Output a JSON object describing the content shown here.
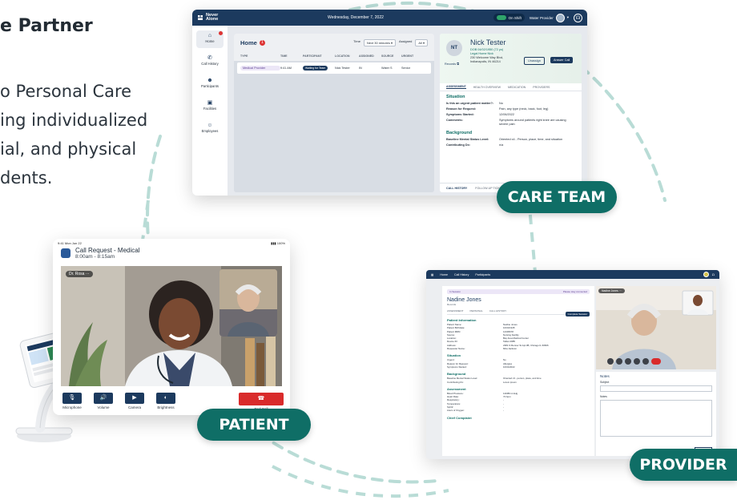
{
  "marketing": {
    "headline": "e Partner",
    "lead_lines": [
      "o Personal Care",
      "ing individualized",
      "ial, and physical",
      "dents."
    ]
  },
  "badges": {
    "care_team": "CARE TEAM",
    "patient": "PATIENT",
    "provider": "PROVIDER"
  },
  "colors": {
    "brand_navy": "#1c3a5e",
    "brand_teal": "#0f6e66",
    "end_call_red": "#d92b2b"
  },
  "care_team": {
    "logo_line1": "Never",
    "logo_line2": "Alone",
    "date": "Wednesday, December 7, 2022",
    "shift_status": "On Shift",
    "provider_label": "Water Provider",
    "nav": [
      {
        "label": "Home",
        "icon": "home-icon"
      },
      {
        "label": "Call History",
        "icon": "phone-icon"
      },
      {
        "label": "Participants",
        "icon": "users-icon"
      },
      {
        "label": "Facilities",
        "icon": "building-icon"
      },
      {
        "label": "Employees",
        "icon": "badge-icon"
      }
    ],
    "home": {
      "title": "Home",
      "count": "1",
      "filter_time_label": "Time",
      "filter_time_value": "Next 30 minutes",
      "filter_assigned_label": "Assigned",
      "filter_assigned_value": "All",
      "columns": [
        "TYPE",
        "TIME",
        "PARTICIPANT",
        "LOCATION",
        "ASSIGNED",
        "SOURCE",
        "URGENT"
      ],
      "rows": [
        {
          "type": "Medical Provider",
          "time": "9:41 AM",
          "status": "Waiting for Team",
          "participant": "Nick Tester",
          "location": "IN",
          "assigned": "Water S",
          "source": "Senior",
          "urgent": "No"
        }
      ]
    },
    "detail": {
      "initials": "NT",
      "name": "Nick Tester",
      "dob": "DOB 04/02/1950 (72 yo)",
      "home": "Legal Home Nick",
      "address1": "230 Welcome Way Blvd,",
      "address2": "Indianapolis, IN 46214",
      "records": "Records",
      "unassign": "Unassign",
      "answer": "Answer Call",
      "tabs": [
        "ASSESSMENT",
        "HEALTH OVERVIEW",
        "MEDICATION",
        "PROVIDERS"
      ],
      "situation_title": "Situation",
      "situation": [
        {
          "k": "Is this an urgent patient matter?:",
          "v": "No"
        },
        {
          "k": "Reason for Request:",
          "v": "Pain, any type (neck, back, foot, leg)"
        },
        {
          "k": "Symptoms Started:",
          "v": "12/06/2022"
        },
        {
          "k": "Comments:",
          "v": "Symptoms around patients right knee are causing severe pain"
        }
      ],
      "background_title": "Background",
      "background": [
        {
          "k": "Baseline Mental Status Level:",
          "v": "Oriented x4 - Person, place, time, and situation"
        },
        {
          "k": "Contributing Dx:",
          "v": "n/a"
        }
      ],
      "foot_tabs": [
        "CALL HISTORY",
        "FOLLOW-UP TICKETS"
      ],
      "expand": "Expand"
    }
  },
  "patient_app": {
    "status_time": "9:41  Mon Jun 22",
    "status_right": "100%",
    "title": "Call Request - Medical",
    "subtitle": "8:00am - 8:15am",
    "doctor_tag": "Dr. Rosa",
    "controls": [
      {
        "label": "Microphone",
        "icon": "microphone-icon"
      },
      {
        "label": "Volume",
        "icon": "volume-icon"
      },
      {
        "label": "Camera",
        "icon": "camera-icon"
      },
      {
        "label": "Brightness",
        "icon": "brightness-icon"
      }
    ],
    "end_call": "End Call"
  },
  "provider_app": {
    "nav": [
      "Home",
      "Call History",
      "Participants"
    ],
    "banner_left": "In Session",
    "banner_right": "Please stay connected",
    "name": "Nadine Jones",
    "records": "Records",
    "schedule": "Complete Session",
    "tabs": [
      "ASSESSMENT",
      "PERSONAL",
      "CALL HISTORY"
    ],
    "patient_info_title": "Patient Information",
    "patient_info": [
      {
        "k": "Patient Name:",
        "v": "Nadine Jones"
      },
      {
        "k": "Patient Birthdate:",
        "v": "10/31/1945"
      },
      {
        "k": "Patient MRN:",
        "v": "12345678"
      },
      {
        "k": "Source:",
        "v": "Nursing Facility"
      },
      {
        "k": "Location:",
        "v": "Bay Area Medical Center"
      },
      {
        "k": "Device ID:",
        "v": "Tablet 4985"
      },
      {
        "k": "Address:",
        "v": "2381 N Renner St Apt 3B, Chicago IL 60606"
      },
      {
        "k": "Requester Name:",
        "v": "Mira Jackson"
      }
    ],
    "situation_title": "Situation",
    "situation": [
      {
        "k": "Urgent:",
        "v": "No"
      },
      {
        "k": "Reason for Request:",
        "v": "Allergies"
      },
      {
        "k": "Symptoms Started:",
        "v": "10/31/2022"
      }
    ],
    "background_title": "Background",
    "background": [
      {
        "k": "Baseline Mental Status Level:",
        "v": "Oriented x3 - person, place, and time"
      },
      {
        "k": "Contributing Dx:",
        "v": "Lorem ipsum"
      }
    ],
    "assessment_title": "Assessment",
    "assessment": [
      {
        "k": "Blood Pressure:",
        "v": "120/80 mmHg"
      },
      {
        "k": "Heart Rate:",
        "v": "72 bpm"
      },
      {
        "k": "Respiratory:",
        "v": "-"
      },
      {
        "k": "Temperature:",
        "v": "-"
      },
      {
        "k": "SpO2:",
        "v": "-"
      },
      {
        "k": "Liters of Oxygen:",
        "v": "-"
      }
    ],
    "chief_title": "Chief Complaint",
    "video_tag": "Nadine Jones",
    "notes_title": "Notes",
    "subject_label": "Subject",
    "notes_label": "Notes",
    "save": "Save Note"
  }
}
